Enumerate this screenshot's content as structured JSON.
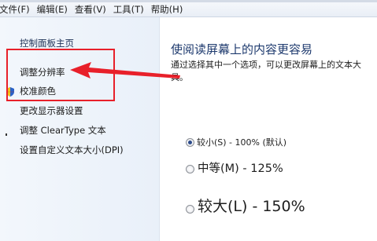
{
  "menubar": {
    "items": [
      "文件(F)",
      "编辑(E)",
      "查看(V)",
      "工具(T)",
      "帮助(H)"
    ]
  },
  "sidebar": {
    "home": "控制面板主页",
    "links": [
      "调整分辨率",
      "校准颜色",
      "更改显示器设置",
      "调整 ClearType 文本",
      "设置自定义文本大小(DPI)"
    ],
    "icon": "uac-shield-icon"
  },
  "main": {
    "title": "使阅读屏幕上的内容更容易",
    "desc_line1": "通过选择其中一个选项，可以更改屏幕上的文本大",
    "desc_line2": "具。",
    "options": [
      {
        "label": "较小(S) - 100% (默认)",
        "checked": true
      },
      {
        "label": "中等(M) - 125%",
        "checked": false
      },
      {
        "label": "较大(L) - 150%",
        "checked": false
      }
    ]
  },
  "annotation": {
    "box_color": "#e8202a",
    "arrow_color": "#e8202a"
  }
}
